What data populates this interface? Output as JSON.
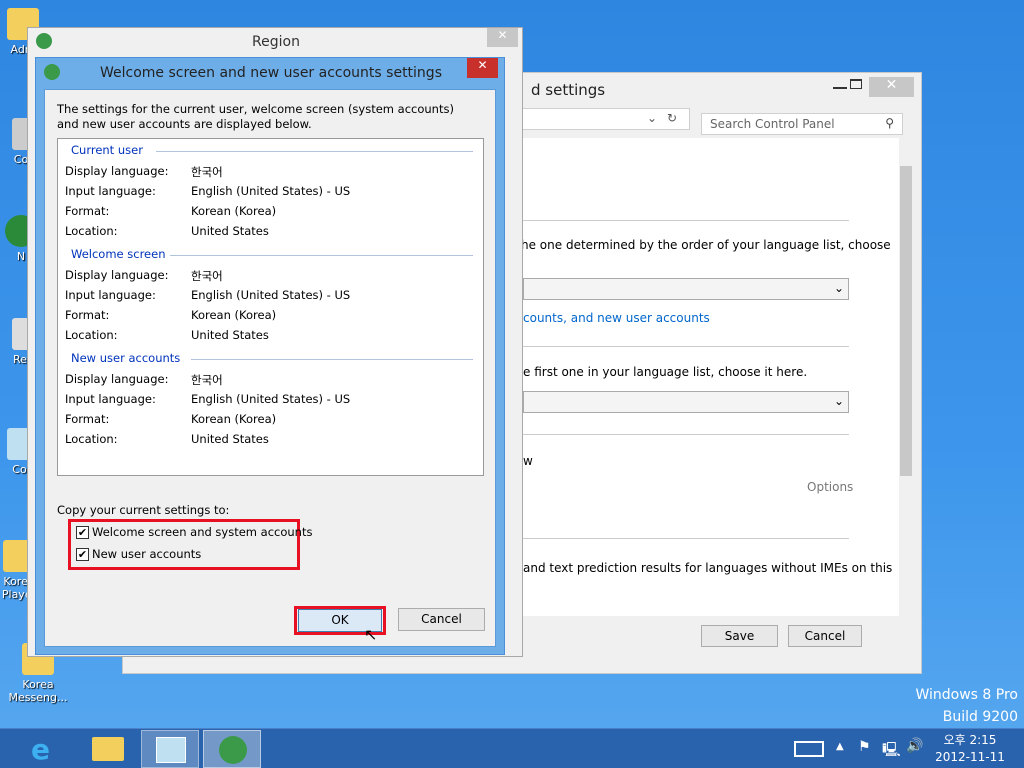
{
  "desktop": {
    "icons": [
      {
        "label": "Adm"
      },
      {
        "label": "Co"
      },
      {
        "label": "N"
      },
      {
        "label": "Rec"
      },
      {
        "label": "Con"
      },
      {
        "label": "Korea Player"
      },
      {
        "label": "Korea Messeng..."
      }
    ],
    "watermark": {
      "line1": "Windows 8 Pro",
      "line2": "Build 9200"
    }
  },
  "control_panel": {
    "title_fragment": "d settings",
    "search_placeholder": "Search Control Panel",
    "texts": [
      "he one determined by the order of your language list, choose",
      "counts, and new user accounts",
      "e first one in your language list, choose it here.",
      "w",
      "Options",
      "and text prediction results for languages without IMEs on this"
    ],
    "save": "Save",
    "cancel": "Cancel"
  },
  "region": {
    "title": "Region"
  },
  "dialog": {
    "title": "Welcome screen and new user accounts settings",
    "description": "The settings for the current user, welcome screen (system accounts) and new user accounts are displayed below.",
    "groups": [
      {
        "name": "Current user",
        "rows": [
          {
            "label": "Display language:",
            "value": "한국어"
          },
          {
            "label": "Input language:",
            "value": "English (United States) - US"
          },
          {
            "label": "Format:",
            "value": "Korean (Korea)"
          },
          {
            "label": "Location:",
            "value": "United States"
          }
        ]
      },
      {
        "name": "Welcome screen",
        "rows": [
          {
            "label": "Display language:",
            "value": "한국어"
          },
          {
            "label": "Input language:",
            "value": "English (United States) - US"
          },
          {
            "label": "Format:",
            "value": "Korean (Korea)"
          },
          {
            "label": "Location:",
            "value": "United States"
          }
        ]
      },
      {
        "name": "New user accounts",
        "rows": [
          {
            "label": "Display language:",
            "value": "한국어"
          },
          {
            "label": "Input language:",
            "value": "English (United States) - US"
          },
          {
            "label": "Format:",
            "value": "Korean (Korea)"
          },
          {
            "label": "Location:",
            "value": "United States"
          }
        ]
      }
    ],
    "copy_label": "Copy your current settings to:",
    "checkboxes": [
      {
        "label": "Welcome screen and system accounts",
        "checked": true
      },
      {
        "label": "New user accounts",
        "checked": true
      }
    ],
    "ok": "OK",
    "cancel": "Cancel",
    "highlight_color": "#e81123"
  },
  "taskbar": {
    "time": "오후 2:15",
    "date": "2012-11-11"
  }
}
